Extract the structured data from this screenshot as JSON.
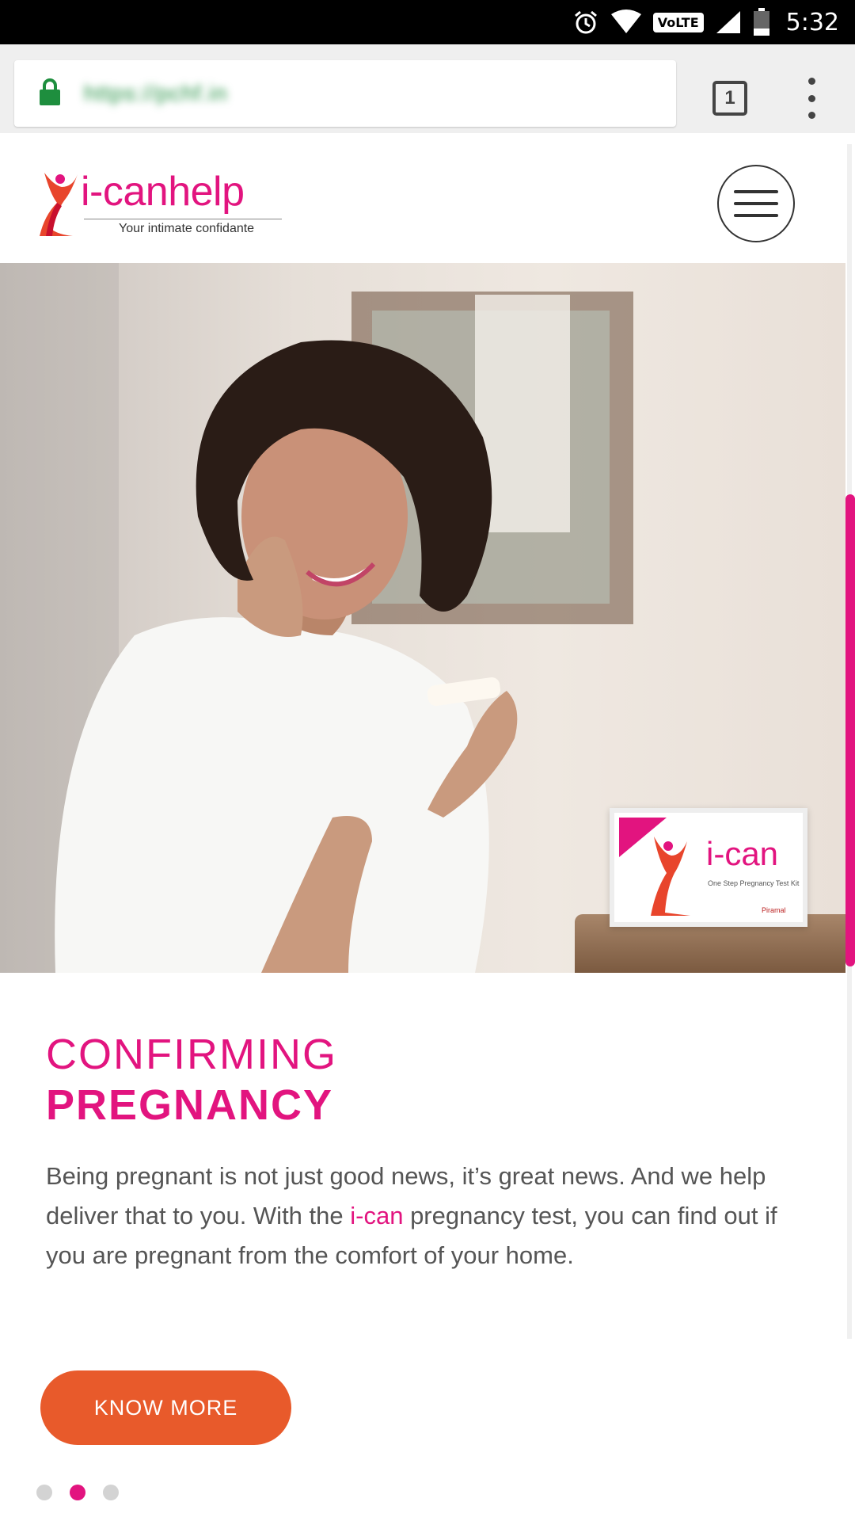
{
  "status_bar": {
    "time": "5:32",
    "icons": [
      "alarm-icon",
      "wifi-icon",
      "volte-icon",
      "signal-icon",
      "battery-icon"
    ],
    "volte_label": "VoLTE"
  },
  "browser": {
    "url": "https://pchf.in",
    "tab_count": "1",
    "icons": [
      "lock-icon",
      "tabs-icon",
      "overflow-menu-icon"
    ]
  },
  "header": {
    "logo_text": "i-canhelp",
    "tagline": "Your intimate confidante",
    "icons": [
      "logo-figure-icon",
      "hamburger-menu-icon"
    ]
  },
  "hero": {
    "product_brand": "i-can",
    "product_sub": "One Step Pregnancy Test Kit",
    "product_maker": "Piramal"
  },
  "slide": {
    "heading_line1": "CONFIRMING",
    "heading_line2": "PREGNANCY",
    "body_part1": "Being pregnant is not just good news, it’s great news. And we help deliver that to you. With the ",
    "body_highlight": "i-can",
    "body_part2": " pregnancy test, you can find out if you are pregnant from the comfort of your home.",
    "cta_label": "KNOW MORE",
    "carousel_total": 3,
    "carousel_active_index": 2
  },
  "colors": {
    "brand_pink": "#e2147f",
    "cta_orange": "#e85a2b",
    "status_bar": "#000000",
    "browser_chrome": "#efefef",
    "lock_green": "#1e8e3e"
  }
}
